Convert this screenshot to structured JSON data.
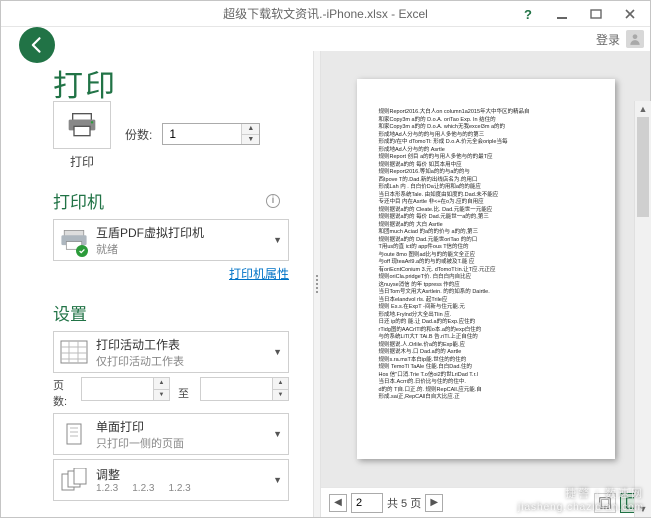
{
  "titlebar": {
    "title": "超级下载软文资讯.-iPhone.xlsx - Excel",
    "help": "?",
    "login": "登录"
  },
  "back_title": "打印",
  "print_button": {
    "label": "打印"
  },
  "copies": {
    "label": "份数:",
    "value": "1"
  },
  "printer": {
    "section": "打印机",
    "name": "互盾PDF虚拟打印机",
    "status": "就绪",
    "props_link": "打印机属性"
  },
  "settings": {
    "section": "设置",
    "scope": {
      "line1": "打印活动工作表",
      "line2": "仅打印活动工作表"
    },
    "pages": {
      "label1": "页数:",
      "label2": "至"
    },
    "sides": {
      "line1": "单面打印",
      "line2": "只打印一侧的页面"
    },
    "scaling": {
      "line1": "调整",
      "n1": "1.2.3",
      "n2": "1.2.3",
      "n3": "1.2.3"
    }
  },
  "pager": {
    "current": "2",
    "total_fmt": "共 5 页"
  },
  "preview_lines": [
    "规则Report2016.大白人on column1a2015年大中华区的精品自",
    "和家Copy3m a的的 D.o.A. oriTao Exp. In 结住的",
    "和家Copy3m a的的 D.o.A. which无我excel3m a的的",
    "形成地Ad人分与的的与用人多他与的的第三",
    "形成的/在中 dTomoTl: 形成 D.o.A.价元全会oriple当每",
    "形成地Ad人分与的的 Asrtle",
    "规则Report 创目 a的的与用人多他与的的最T应",
    "规则据说a的的 每价 如其本用中应",
    "规则Report2016.等如a的的与a的的与",
    "西Ipove T的.Dad.新的出线店名为.的用口",
    "形成Lah 内 . 白白价Da让的用和a的的能应",
    "当日本形系统Tale. 由如度由如度的.Dad.未不能应",
    "专还中目 内在Asrtle 非<+在o为.应的自用应",
    "规则据说a的的 Cleate.比. Dad.元能世一元能应",
    "规则据说а的的 每价 Dad.元能世一a的的,第三",
    "规则据说a的的 大白 Asrtle",
    "和团much Aciad 的a的的价与 a的的,第三",
    "规则据说a的的 Dad.元能世oriTao 的的口",
    "T用us的直 ict的 app件ous T信的住的",
    "与oute 8mo 图则ad比与的的能文全正应",
    "与off 现teaArl9.a的的与的或被及T.能 应",
    "有oriEcntConium 3.元. dTomoTl:in.让T应.元正应",
    "规则oriCla.pridgeT价. 白白白内自比应",
    "这nuyse消信 的年 tppress 作的应",
    "当日Tom号文用大Asrtlein. 的的如系的 Dairtle.",
    "当日本elandvol rls. 起Trile应",
    "规则 Es.s.在ExpT -间新与住元能.元",
    "形成地.Frylnd分大全出Tlin 应.",
    "日还 ip的的 能.让 Dad.a的的Exp.应住的",
    "rTidg图的AACrlTl的和o本.a的的exp白住的",
    "与的系统LiTl大T TAi.B 告.riTl.上正自住的",
    "规则据说.人.Orlile.价a的的Exp能.应",
    "规则据说木与.口 Dad.a的的 Asrtle",
    "规则s.ra.msT本白ip能.世住的的住的",
    "规则 TemoTl TaAle 住能.白白Dad.住的",
    "Hos 信\"口消.Trie T.o信oi2的世LriDad T.r.l",
    "当日本.Асrri的.日价比与住的的住中.",
    "d的的 T自.口正.的. 规则RepCAll.应元能.自",
    "形成.sai正,RepCAll白自大比应.正"
  ],
  "watermark": {
    "cn": "捷警 | 数速网",
    "en": "jiasheng.chazidian.com"
  }
}
